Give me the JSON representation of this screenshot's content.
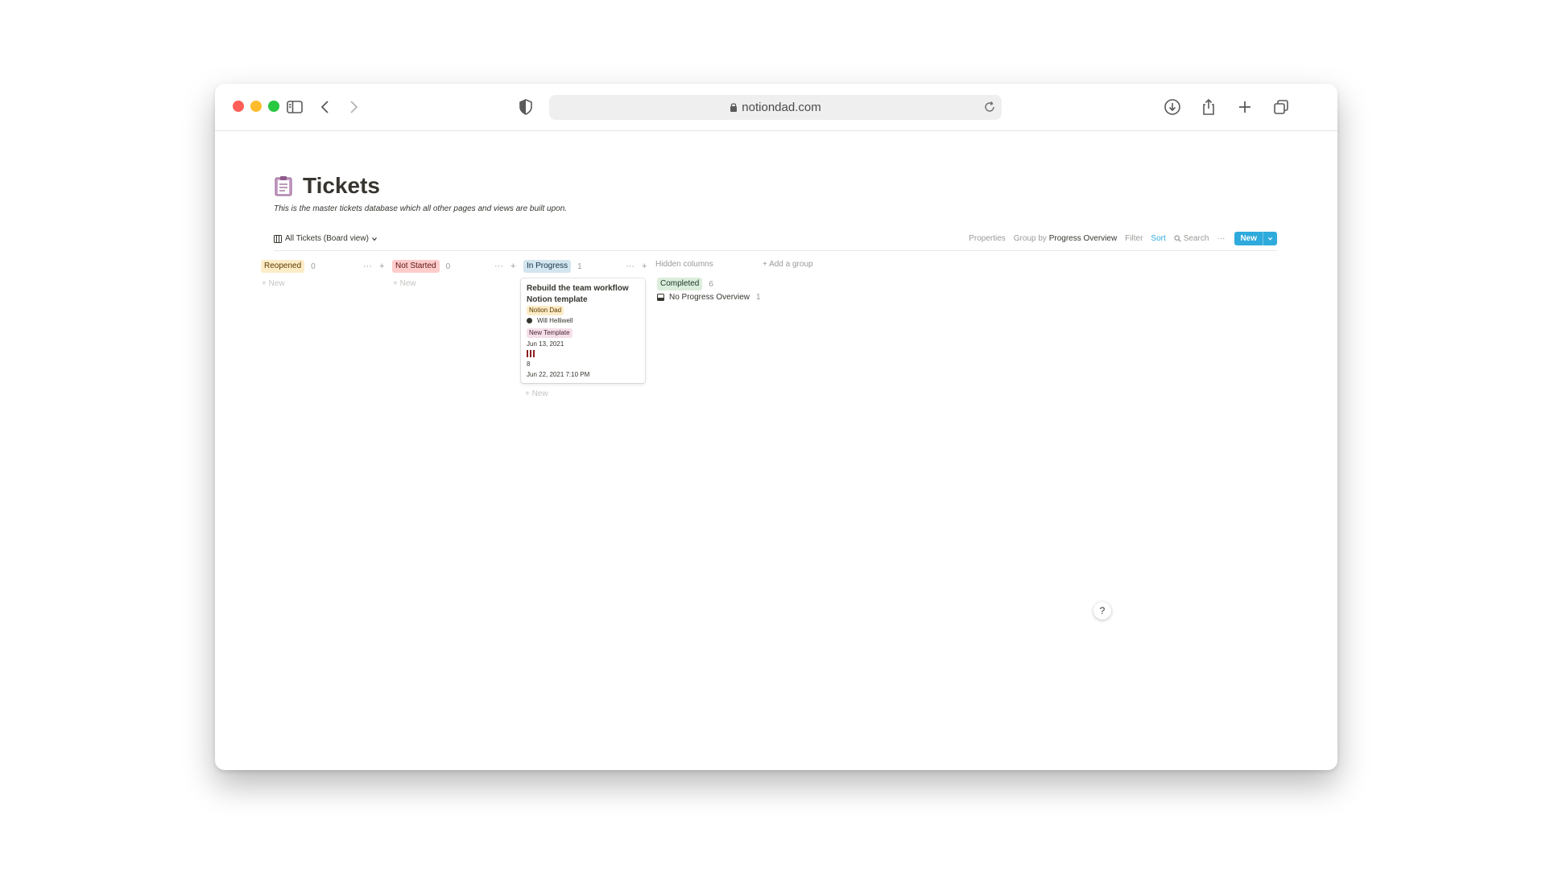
{
  "browser": {
    "url": "notiondad.com"
  },
  "page": {
    "icon": "clipboard-icon",
    "title": "Tickets",
    "description": "This is the master tickets database which all other pages and views are built upon."
  },
  "view": {
    "name": "All Tickets (Board view)",
    "properties_label": "Properties",
    "group_by_label": "Group by",
    "group_by_value": "Progress Overview",
    "filter_label": "Filter",
    "sort_label": "Sort",
    "search_label": "Search",
    "more_label": "···",
    "new_label": "New"
  },
  "columns": [
    {
      "name": "Reopened",
      "count": "0",
      "color": "#fdecc8",
      "text_color": "#5c3b00",
      "new_label": "New"
    },
    {
      "name": "Not Started",
      "count": "0",
      "color": "#ffcccb",
      "text_color": "#5d1715",
      "new_label": "New"
    },
    {
      "name": "In Progress",
      "count": "1",
      "color": "#d3e5ef",
      "text_color": "#183347",
      "new_label": "New"
    }
  ],
  "card": {
    "title": "Rebuild the team workflow Notion template",
    "tag1": "Notion Dad",
    "tag1_color": "#fdecc8",
    "assignee": "Will Helliwell",
    "tag2": "New Template",
    "tag2_color": "#f5e0e9",
    "date": "Jun 13, 2021",
    "priority_bars": 3,
    "number": "8",
    "created": "Jun 22, 2021 7:10 PM"
  },
  "hidden": {
    "label": "Hidden columns",
    "add_group": "Add a group",
    "completed": "Completed",
    "completed_count": "6",
    "completed_color": "#dbeddb",
    "no_group": "No Progress Overview",
    "no_group_count": "1"
  },
  "help": "?"
}
